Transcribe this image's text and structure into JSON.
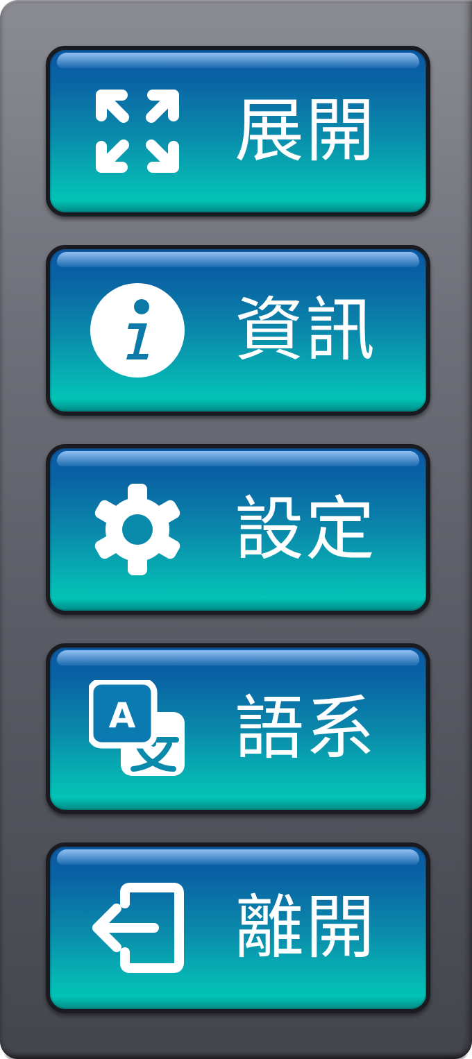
{
  "menu": {
    "items": [
      {
        "id": "expand",
        "label": "展開",
        "icon": "expand-icon"
      },
      {
        "id": "info",
        "label": "資訊",
        "icon": "info-icon"
      },
      {
        "id": "settings",
        "label": "設定",
        "icon": "gear-icon"
      },
      {
        "id": "language",
        "label": "語系",
        "icon": "translate-icon",
        "icon_text": "A"
      },
      {
        "id": "exit",
        "label": "離開",
        "icon": "exit-icon"
      }
    ]
  },
  "colors": {
    "panel_top": "#8b8c93",
    "panel_bottom": "#44454d",
    "button_top": "#0c5aa5",
    "button_bottom": "#00cdb8",
    "button_border": "#1a1b20",
    "text": "#ffffff"
  }
}
